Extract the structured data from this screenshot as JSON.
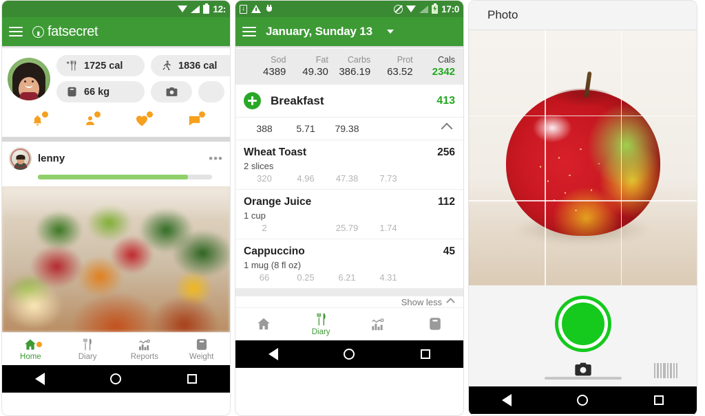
{
  "panels": {
    "home": {
      "status_bar": {
        "time": "12:",
        "icons": [
          "wifi-icon",
          "signal-icon",
          "battery-icon"
        ]
      },
      "app_bar": {
        "menu_icon": "hamburger-menu-icon",
        "brand": "fatsecret",
        "brand_mark": "fatsecret-logo-icon"
      },
      "summary_pills": [
        {
          "icon": "add-food-icon",
          "value": "1725 cal"
        },
        {
          "icon": "exercise-runner-icon",
          "value": "1836 cal"
        },
        {
          "icon": "weight-scale-icon",
          "value": "66 kg"
        },
        {
          "icon": "camera-icon",
          "value": ""
        },
        {
          "icon": "",
          "value": ""
        }
      ],
      "social_icons": [
        {
          "name": "bell-notifications-icon",
          "badge": true
        },
        {
          "name": "person-friends-icon",
          "badge": true
        },
        {
          "name": "heart-likes-icon",
          "badge": true
        },
        {
          "name": "chat-comments-icon",
          "badge": true
        }
      ],
      "feed": {
        "user": "lenny",
        "menu_icon": "more-options-icon",
        "progress_percent": 86,
        "photo_alt": "salmon-salad-photo"
      },
      "tabs": [
        {
          "label": "Home",
          "icon": "home-icon",
          "active": true,
          "badge": true
        },
        {
          "label": "Diary",
          "icon": "cutlery-icon",
          "active": false,
          "badge": false
        },
        {
          "label": "Reports",
          "icon": "chart-icon",
          "active": false,
          "badge": false
        },
        {
          "label": "Weight",
          "icon": "weight-scale-icon",
          "active": false,
          "badge": false
        }
      ]
    },
    "diary": {
      "status_bar": {
        "time": "17:0",
        "icons": [
          "download-icon",
          "warning-icon",
          "plug-icon",
          "no-ring-icon",
          "wifi-icon",
          "signal-icon",
          "battery-charging-icon"
        ]
      },
      "app_bar": {
        "menu_icon": "hamburger-menu-icon",
        "title": "January, Sunday 13",
        "caret": "chevron-down-icon"
      },
      "macros": {
        "keys": [
          "Sod",
          "Fat",
          "Carbs",
          "Prot",
          "Cals"
        ],
        "values": [
          "4389",
          "49.30",
          "386.19",
          "63.52",
          "2342"
        ]
      },
      "meal": {
        "add_icon": "add-circle-icon",
        "name": "Breakfast",
        "calories": "413",
        "totals": [
          "388",
          "5.71",
          "79.38",
          ""
        ],
        "collapse_icon": "chevron-up-icon"
      },
      "foods": [
        {
          "name": "Wheat Toast",
          "calories": "256",
          "serving": "2 slices",
          "macros": [
            "320",
            "4.96",
            "47.38",
            "7.73"
          ]
        },
        {
          "name": "Orange Juice",
          "calories": "112",
          "serving": "1 cup",
          "macros": [
            "2",
            "",
            "25.79",
            "1.74"
          ]
        },
        {
          "name": "Cappuccino",
          "calories": "45",
          "serving": "1 mug (8 fl oz)",
          "macros": [
            "66",
            "0.25",
            "6.21",
            "4.31"
          ]
        }
      ],
      "show_less": {
        "label": "Show less",
        "icon": "chevron-up-icon"
      },
      "tabs": [
        {
          "label": "",
          "icon": "home-icon",
          "active": false
        },
        {
          "label": "Diary",
          "icon": "cutlery-icon",
          "active": true
        },
        {
          "label": "",
          "icon": "chart-icon",
          "active": false
        },
        {
          "label": "",
          "icon": "weight-scale-icon",
          "active": false
        }
      ]
    },
    "camera": {
      "title": "Photo",
      "viewfinder_alt": "apple-on-wooden-table-photo",
      "grid_overlay": true,
      "shutter_button": "shutter-button",
      "modes": [
        {
          "name": "camera-mode-icon",
          "active": true
        },
        {
          "name": "barcode-mode-icon",
          "active": false
        }
      ]
    }
  },
  "colors": {
    "brand_green": "#3d9a35",
    "status_green": "#3a8a33",
    "accent_green": "#22a81e",
    "shutter_green": "#15c91d",
    "badge_orange": "#f5a01e",
    "progress_green": "#8fd06a"
  }
}
